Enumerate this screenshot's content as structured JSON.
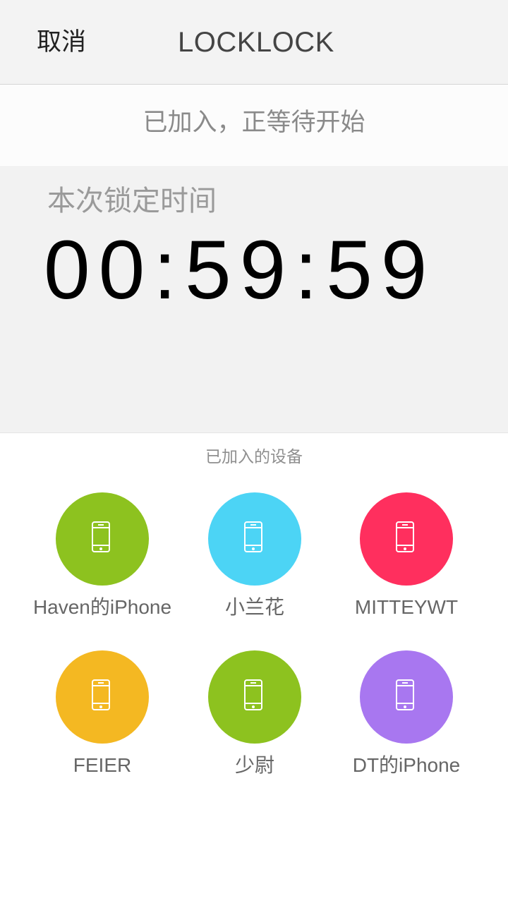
{
  "header": {
    "cancel_label": "取消",
    "title": "LOCKLOCK"
  },
  "status": {
    "text": "已加入，正等待开始"
  },
  "lock": {
    "label": "本次锁定时间",
    "time": "00:59:59"
  },
  "devices": {
    "title": "已加入的设备",
    "items": [
      {
        "name": "Haven的iPhone",
        "color": "#8dc21f",
        "icon": "phone-icon"
      },
      {
        "name": "小兰花",
        "color": "#4cd4f5",
        "icon": "phone-icon"
      },
      {
        "name": "MITTEYWT",
        "color": "#ff2f5e",
        "icon": "phone-icon"
      },
      {
        "name": "FEIER",
        "color": "#f4b822",
        "icon": "phone-icon"
      },
      {
        "name": "少尉",
        "color": "#8dc21f",
        "icon": "phone-icon"
      },
      {
        "name": "DT的iPhone",
        "color": "#a877f0",
        "icon": "phone-icon"
      }
    ]
  }
}
